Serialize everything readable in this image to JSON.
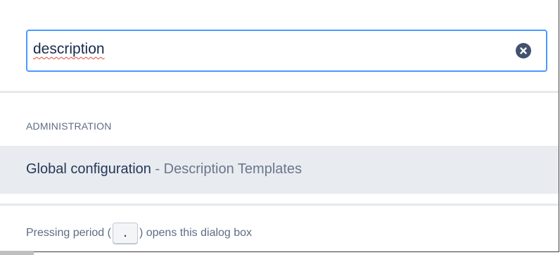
{
  "search": {
    "value": "description",
    "clear_icon": "clear-icon"
  },
  "results": {
    "section_label": "ADMINISTRATION",
    "items": [
      {
        "title": "Global configuration",
        "separator": " - ",
        "subtitle": "Description Templates"
      }
    ]
  },
  "footer": {
    "prefix": "Pressing period (",
    "key": ".",
    "suffix": ") opens this dialog box"
  },
  "colors": {
    "focus_border": "#4c9aff",
    "highlight_row": "#e8ebef",
    "muted_text": "#5e6c84"
  }
}
